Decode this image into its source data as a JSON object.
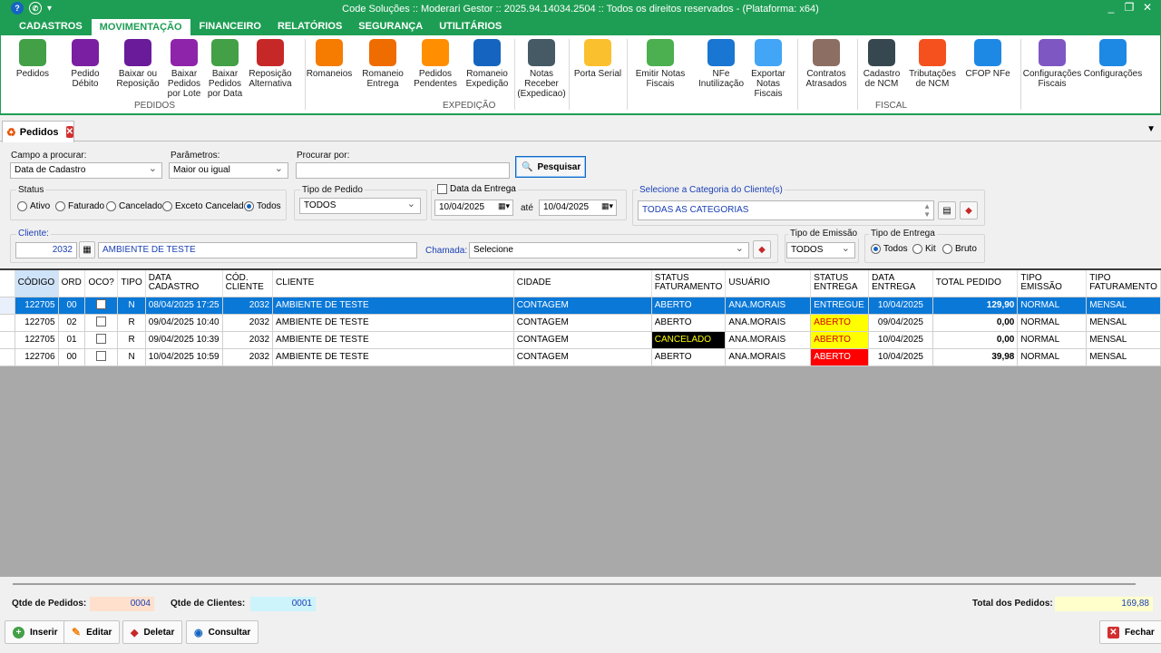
{
  "titlebar": {
    "title": "Code Soluções :: Moderari Gestor :: 2025.94.14034.2504 :: Todos os direitos reservados - (Plataforma: x64)",
    "help": "?",
    "whatsapp": "✆",
    "more": "▾"
  },
  "menu_tabs": [
    "CADASTROS",
    "MOVIMENTAÇÃO",
    "FINANCEIRO",
    "RELATÓRIOS",
    "SEGURANÇA",
    "UTILITÁRIOS"
  ],
  "ribbon": {
    "buttons": [
      {
        "label": "Pedidos",
        "icon": "add-order-icon",
        "color": "#43a047"
      },
      {
        "label": "Pedido\nDébito",
        "icon": "basket-debit-icon",
        "color": "#7b1fa2"
      },
      {
        "label": "Baixar ou\nReposição",
        "icon": "basket-refresh-icon",
        "color": "#6a1b9a"
      },
      {
        "label": "Baixar\nPedidos\npor Lote",
        "icon": "basket-batch-icon",
        "color": "#8e24aa"
      },
      {
        "label": "Baixar\nPedidos\npor Data",
        "icon": "basket-date-icon",
        "color": "#43a047"
      },
      {
        "label": "Reposição\nAlternativa",
        "icon": "basket-alt-icon",
        "color": "#c62828"
      },
      {
        "label": "Romaneios",
        "icon": "truck-icon",
        "color": "#f57c00"
      },
      {
        "label": "Romaneio\nEntrega",
        "icon": "delivery-icon",
        "color": "#ef6c00"
      },
      {
        "label": "Pedidos\nPendentes",
        "icon": "cart-pending-icon",
        "color": "#ff8f00"
      },
      {
        "label": "Romaneio\nExpedição",
        "icon": "clipboard-icon",
        "color": "#1565c0"
      },
      {
        "label": "Notas\nReceber\n(Expedicao)",
        "icon": "printer-icon",
        "color": "#455a64"
      },
      {
        "label": "Porta Serial",
        "icon": "serial-port-icon",
        "color": "#fbc02d"
      },
      {
        "label": "Emitir Notas\nFiscais",
        "icon": "invoice-icon",
        "color": "#4caf50"
      },
      {
        "label": "NFe\nInutilização",
        "icon": "nfe-cancel-icon",
        "color": "#1976d2"
      },
      {
        "label": "Exportar\nNotas\nFiscais",
        "icon": "zip-export-icon",
        "color": "#42a5f5"
      },
      {
        "label": "Contratos\nAtrasados",
        "icon": "cash-register-icon",
        "color": "#8d6e63"
      },
      {
        "label": "Cadastro\nde NCM",
        "icon": "monitor-icon",
        "color": "#37474f"
      },
      {
        "label": "Tributações\nde NCM",
        "icon": "filter-icon",
        "color": "#f4511e"
      },
      {
        "label": "CFOP NFe",
        "icon": "code-icon",
        "color": "#1e88e5"
      },
      {
        "label": "Configurações\nFiscais",
        "icon": "gears-icon",
        "color": "#7e57c2"
      },
      {
        "label": "Configurações",
        "icon": "gear-icon",
        "color": "#1e88e5"
      }
    ],
    "groups": [
      "PEDIDOS",
      "EXPEDIÇÃO",
      "FISCAL"
    ]
  },
  "doc_tab": {
    "label": "Pedidos",
    "close": "✕"
  },
  "filters": {
    "campo_label": "Campo a procurar:",
    "campo_value": "Data de Cadastro",
    "param_label": "Parâmetros:",
    "param_value": "Maior ou igual",
    "procurar_label": "Procurar por:",
    "procurar_value": "",
    "pesquisar": "Pesquisar",
    "status_label": "Status",
    "status_options": [
      "Ativo",
      "Faturado",
      "Cancelado",
      "Exceto Cancelado",
      "Todos"
    ],
    "status_selected": "Todos",
    "tipo_pedido_label": "Tipo de Pedido",
    "tipo_pedido_value": "TODOS",
    "data_entrega_label": "Data da Entrega",
    "date_from": "10/04/2025",
    "ate": "até",
    "date_to": "10/04/2025",
    "categoria_label": "Selecione a Categoria do Cliente(s)",
    "categoria_value": "TODAS AS CATEGORIAS",
    "cliente_label": "Cliente:",
    "cliente_code": "2032",
    "cliente_name": "AMBIENTE DE TESTE",
    "chamada_label": "Chamada:",
    "chamada_value": "Selecione",
    "tipo_emissao_label": "Tipo de Emissão",
    "tipo_emissao_value": "TODOS",
    "tipo_entrega_label": "Tipo de Entrega",
    "tipo_entrega_options": [
      "Todos",
      "Kit",
      "Bruto"
    ],
    "tipo_entrega_selected": "Todos"
  },
  "grid": {
    "columns": [
      "CÓDIGO",
      "ORD",
      "OCO?",
      "TIPO",
      "DATA\nCADASTRO",
      "CÓD.\nCLIENTE",
      "CLIENTE",
      "CIDADE",
      "STATUS\nFATURAMENTO",
      "USUÁRIO",
      "STATUS\nENTREGA",
      "DATA\nENTREGA",
      "TOTAL PEDIDO",
      "TIPO\nEMISSÃO",
      "TIPO\nFATURAMENTO"
    ],
    "rows": [
      {
        "codigo": "122705",
        "ord": "00",
        "tipo": "N",
        "data_cadastro": "08/04/2025 17:25",
        "cod_cliente": "2032",
        "cliente": "AMBIENTE DE TESTE",
        "cidade": "CONTAGEM",
        "status_fat": "ABERTO",
        "usuario": "ANA.MORAIS",
        "status_ent": "ENTREGUE",
        "data_entrega": "10/04/2025",
        "total": "129,90",
        "tipo_emissao": "NORMAL",
        "tipo_fat": "MENSAL"
      },
      {
        "codigo": "122705",
        "ord": "02",
        "tipo": "R",
        "data_cadastro": "09/04/2025 10:40",
        "cod_cliente": "2032",
        "cliente": "AMBIENTE DE TESTE",
        "cidade": "CONTAGEM",
        "status_fat": "ABERTO",
        "usuario": "ANA.MORAIS",
        "status_ent": "ABERTO",
        "data_entrega": "09/04/2025",
        "total": "0,00",
        "tipo_emissao": "NORMAL",
        "tipo_fat": "MENSAL"
      },
      {
        "codigo": "122705",
        "ord": "01",
        "tipo": "R",
        "data_cadastro": "09/04/2025 10:39",
        "cod_cliente": "2032",
        "cliente": "AMBIENTE DE TESTE",
        "cidade": "CONTAGEM",
        "status_fat": "CANCELADO",
        "usuario": "ANA.MORAIS",
        "status_ent": "ABERTO",
        "data_entrega": "10/04/2025",
        "total": "0,00",
        "tipo_emissao": "NORMAL",
        "tipo_fat": "MENSAL"
      },
      {
        "codigo": "122706",
        "ord": "00",
        "tipo": "N",
        "data_cadastro": "10/04/2025 10:59",
        "cod_cliente": "2032",
        "cliente": "AMBIENTE DE TESTE",
        "cidade": "CONTAGEM",
        "status_fat": "ABERTO",
        "usuario": "ANA.MORAIS",
        "status_ent": "ABERTO",
        "data_entrega": "10/04/2025",
        "total": "39,98",
        "tipo_emissao": "NORMAL",
        "tipo_fat": "MENSAL"
      }
    ]
  },
  "totals": {
    "qtde_pedidos_label": "Qtde de Pedidos:",
    "qtde_pedidos": "0004",
    "qtde_clientes_label": "Qtde de Clientes:",
    "qtde_clientes": "0001",
    "total_label": "Total dos Pedidos:",
    "total": "169,88"
  },
  "actions": {
    "inserir": "Inserir",
    "editar": "Editar",
    "deletar": "Deletar",
    "consultar": "Consultar",
    "fechar": "Fechar"
  },
  "colors": {
    "brand_green": "#1e9e54",
    "selection_blue": "#0a78d7",
    "status_yellow": "#ffff00",
    "status_red": "#ff0000",
    "link_blue": "#1a3fb5"
  }
}
